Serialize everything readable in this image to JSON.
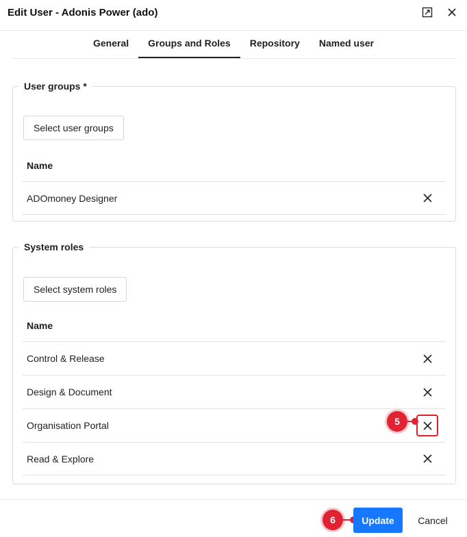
{
  "dialog": {
    "title": "Edit User - Adonis Power (ado)",
    "expand_icon": "expand-icon",
    "close_icon": "close-icon"
  },
  "tabs": [
    {
      "label": "General",
      "active": false
    },
    {
      "label": "Groups and Roles",
      "active": true
    },
    {
      "label": "Repository",
      "active": false
    },
    {
      "label": "Named user",
      "active": false
    }
  ],
  "user_groups": {
    "legend": "User groups *",
    "select_label": "Select user groups",
    "column_header": "Name",
    "rows": [
      {
        "name": "ADOmoney Designer",
        "remove_icon": "close-icon"
      }
    ]
  },
  "system_roles": {
    "legend": "System roles",
    "select_label": "Select system roles",
    "column_header": "Name",
    "rows": [
      {
        "name": "Control & Release",
        "remove_icon": "close-icon"
      },
      {
        "name": "Design & Document",
        "remove_icon": "close-icon"
      },
      {
        "name": "Organisation Portal",
        "remove_icon": "close-icon",
        "highlighted": true
      },
      {
        "name": "Read & Explore",
        "remove_icon": "close-icon"
      }
    ]
  },
  "footer": {
    "update_label": "Update",
    "cancel_label": "Cancel"
  },
  "annotations": [
    {
      "label": "5",
      "target": "remove Organisation Portal"
    },
    {
      "label": "6",
      "target": "Update button"
    }
  ],
  "colors": {
    "accent": "#1677ff",
    "annotation": "#e02232",
    "highlight_border": "#e11d2a"
  }
}
